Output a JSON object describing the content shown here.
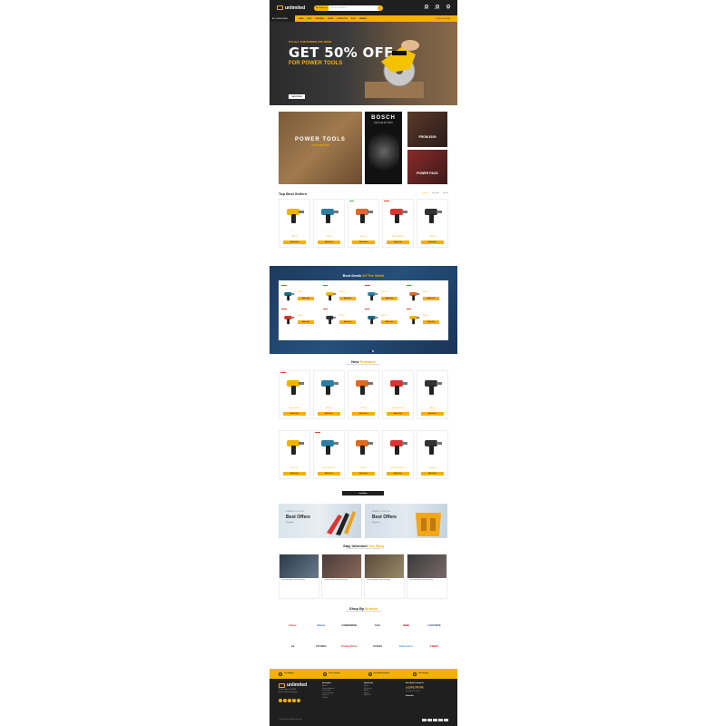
{
  "header": {
    "logo": "unlimited",
    "search_category": "All Categories",
    "search_placeholder": "Search for products",
    "icons": [
      "heart-icon",
      "user-icon",
      "cart-icon"
    ],
    "icon_labels": [
      "Wishlist",
      "Account",
      "Cart"
    ]
  },
  "nav": {
    "all_categories": "ALL CATEGORIES",
    "items": [
      "HOME",
      "SHOP",
      "FEATURES",
      "PAGES",
      "CONTACT US",
      "BLOG",
      "BRANDS"
    ],
    "phone": "+1 (987) 456-1230"
  },
  "hero": {
    "small": "IT'S ALL THE POWER YOU NEED",
    "big": "GET 50% OFF",
    "sub": "FOR POWER TOOLS",
    "button": "SHOP NOW"
  },
  "banners": {
    "b1_title": "POWER TOOLS",
    "b1_sub": "UP TO 50% OFF",
    "b2_title": "BOSCH",
    "b2_sub": "COLLECTION",
    "b3_title": "FROM $150",
    "b4_title": "POWER PACK"
  },
  "top_sellers": {
    "title": "Top Best Sellers",
    "tabs": [
      "Featured",
      "Bestseller",
      "Special"
    ],
    "products": [
      {
        "name": "Bosch Angle Grinder 115mm",
        "price": "$39.00",
        "badge": "",
        "add": "Add to Cart"
      },
      {
        "name": "Stanley Measuring Tape 8m",
        "price": "$19.00",
        "badge": "",
        "add": "Add to Cart"
      },
      {
        "name": "Makita Work Radio DAB",
        "price": "$119.00",
        "badge": "New",
        "add": "Add to Cart"
      },
      {
        "name": "Socket Set 108 Piece",
        "price": "$49.00 $69.00",
        "badge": "-15%",
        "add": "Add to Cart"
      },
      {
        "name": "Knipex Pliers Wrench 180mm",
        "price": "$29.00",
        "badge": "",
        "add": "Add to Cart"
      }
    ]
  },
  "deals": {
    "title_a": "Best Deals",
    "title_b": "Of The Week",
    "items": [
      {
        "name": "Bosch Combi Drill 18V",
        "price": "$89.00",
        "badge": "-10%",
        "add": "Add to Cart"
      },
      {
        "name": "Makita Rotary Hammer",
        "price": "$129.00",
        "badge": "-8%",
        "add": "Add to Cart"
      },
      {
        "name": "DeWalt Rotary Drill",
        "price": "$149.00",
        "badge": "-12%",
        "add": "Add to Cart"
      },
      {
        "name": "Bosch Cordless Drill Driver",
        "price": "$99.00",
        "badge": "-5%",
        "add": "Add to Cart"
      },
      {
        "name": "Bosch Angle Grinder Set",
        "price": "$59.00",
        "badge": "-10%",
        "add": "Add to Cart"
      },
      {
        "name": "Makita Impact Drill",
        "price": "$79.00",
        "badge": "-7%",
        "add": "Add to Cart"
      },
      {
        "name": "Bosch Work Radio",
        "price": "$109.00",
        "badge": "-6%",
        "add": "Add to Cart"
      },
      {
        "name": "Circular Saw Blade Set",
        "price": "$39.00",
        "badge": "-9%",
        "add": "Add to Cart"
      }
    ]
  },
  "new_products": {
    "title_a": "New",
    "title_b": "Products",
    "subtitle": "Lorem ipsum dolor sit amet, consectetur adipiscing elit",
    "row1": [
      {
        "name": "Bosch Pro Rotary Hammer Drill",
        "price": "$89.00 $99.00",
        "badge": "-10%",
        "add": "Add to Cart"
      },
      {
        "name": "Bosch Circular Saw 190mm",
        "price": "$129.00",
        "badge": "",
        "add": "Add to Cart"
      },
      {
        "name": "Bosch Drywall Screwdriver",
        "price": "$79.00",
        "badge": "",
        "add": "Add to Cart"
      },
      {
        "name": "Makita Cordless Drill Driver",
        "price": "$69.00 $79.00",
        "badge": "",
        "add": "Add to Cart"
      },
      {
        "name": "Bosch Dust Extraction",
        "price": "$49.00",
        "badge": "",
        "add": "Add to Cart"
      }
    ],
    "row2": [
      {
        "name": "Bosch Demolition Hammer",
        "price": "$199.00",
        "badge": "",
        "add": "Add to Cart"
      },
      {
        "name": "Bosch Rotary Hammer SDS",
        "price": "$99.00 $119.00",
        "badge": "-15%",
        "add": "Add to Cart"
      },
      {
        "name": "Bosch Impact Drill Set",
        "price": "$89.00",
        "badge": "",
        "add": "Add to Cart"
      },
      {
        "name": "DeWalt Worksite Radio",
        "price": "$119.00 $139.00",
        "badge": "",
        "add": "Add to Cart"
      },
      {
        "name": "DeWalt Cordless Drill",
        "price": "$109.00",
        "badge": "",
        "add": "Add to Cart"
      }
    ],
    "load_more": "Load More"
  },
  "offers": [
    {
      "small": "SUMMER COLLECTION",
      "title": "Best Offers",
      "link": "Shop Now"
    },
    {
      "small": "SUMMER COLLECTION",
      "title": "Best Offers",
      "link": "Shop Now"
    }
  ],
  "blog": {
    "title_a": "Stay Informed",
    "title_b": "Our Blog",
    "subtitle": "Lorem ipsum dolor sit amet, consectetur adipiscing elit",
    "posts": [
      "Lorem ipsum dolor sit amet consectetur",
      "Lorem ipsum dolor sit amet consectetur",
      "Lorem ipsum dolor sit amet consectetur",
      "Lorem ipsum dolor sit amet consectetur"
    ]
  },
  "brands": {
    "title_a": "Shop By",
    "title_b": "Brands",
    "subtitle": "Lorem ipsum dolor sit amet, consectetur adipiscing elit",
    "items": [
      "Dolce",
      "chicco",
      "CONVERSE",
      "fitbit",
      "H&M",
      "LACOSTE",
      "ck",
      "CITIZEN",
      "Fisher-Price",
      "GUCCI",
      "Johnson's",
      "LEGO"
    ]
  },
  "features": [
    "Free Shipping",
    "Secure Payment",
    "Money Back Guarantee",
    "Online Support"
  ],
  "footer": {
    "logo": "unlimited",
    "address": [
      "Cecilia Chapman 711-2880",
      "Nulla St. Mankato Mississippi"
    ],
    "col1_head": "Information",
    "col1": [
      "About Us",
      "Delivery Information",
      "Privacy Policy",
      "Terms & Conditions",
      "Contact Us",
      "Site Map"
    ],
    "col2_head": "Quick Links",
    "col2": [
      "Brands",
      "Gift Vouchers",
      "Affiliates",
      "Specials",
      "My Account"
    ],
    "col3_head": "Need Help? Contact Us",
    "phone": "+1 (012) 456-789",
    "hours": [
      "Monday - Friday: 9:00 - 20:00",
      "Saturday: 11:00 - 15:00"
    ],
    "newsletter": "Subscribe",
    "copyright": "© 2024 Unlimited. All Rights Reserved."
  },
  "colors": {
    "accent": "#f5b100",
    "dark": "#1f1f1f",
    "sale": "#e8442a"
  }
}
